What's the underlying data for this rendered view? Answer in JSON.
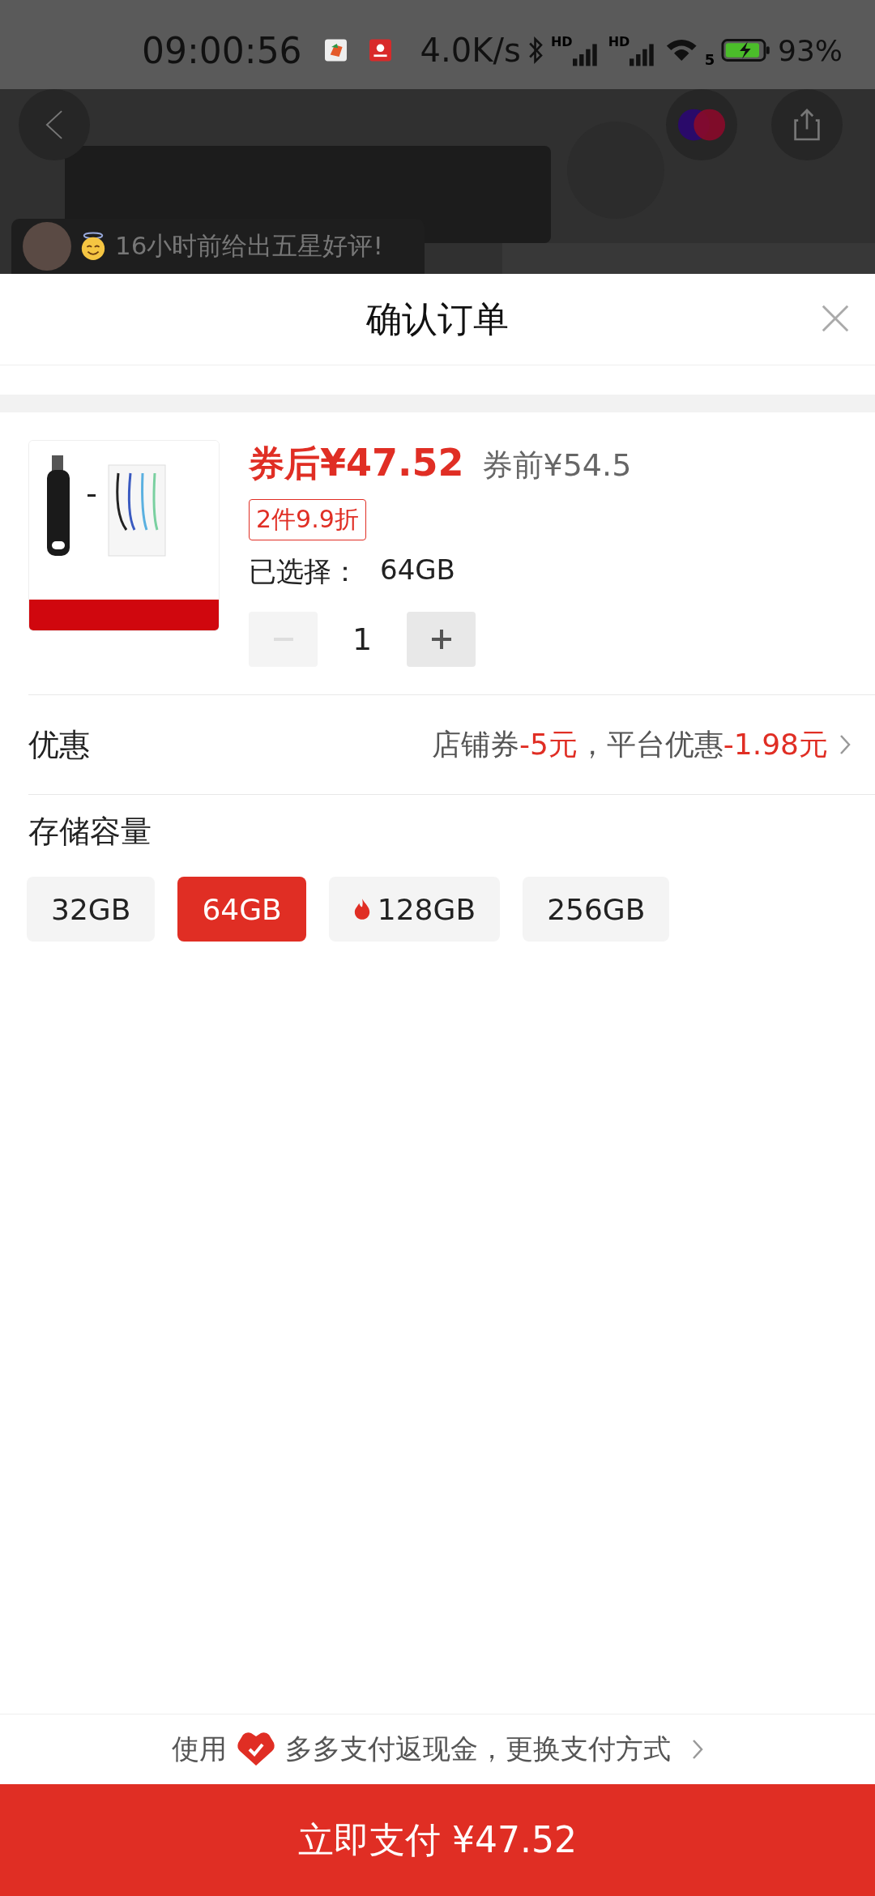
{
  "status_bar": {
    "time": "09:00:56",
    "speed": "4.0K/s",
    "signal_labels": [
      "HD",
      "HD"
    ],
    "wifi_label": "5",
    "battery": "93%",
    "charging": true
  },
  "review_toast": {
    "text": "16小时前给出五星好评!"
  },
  "sheet": {
    "title": "确认订单"
  },
  "product": {
    "price_label": "券后",
    "price": "¥47.52",
    "original_price": "券前¥54.5",
    "promo_tag": "2件9.9折",
    "selected_label": "已选择：",
    "selected_value": "64GB",
    "quantity": "1",
    "minus_disabled": true
  },
  "discount": {
    "label": "优惠",
    "parts": [
      {
        "text": "店铺券",
        "kind": "plain"
      },
      {
        "text": "-5元",
        "kind": "amount"
      },
      {
        "text": "，平台优惠",
        "kind": "plain"
      },
      {
        "text": "-1.98元",
        "kind": "amount"
      }
    ]
  },
  "options": {
    "title": "存储容量",
    "items": [
      {
        "label": "32GB",
        "selected": false,
        "hot": false
      },
      {
        "label": "64GB",
        "selected": true,
        "hot": false
      },
      {
        "label": "128GB",
        "selected": false,
        "hot": true
      },
      {
        "label": "256GB",
        "selected": false,
        "hot": false
      }
    ]
  },
  "payment_hint": {
    "prefix": "使用",
    "text": "多多支付返现金，更换支付方式"
  },
  "pay_button": "立即支付 ¥47.52"
}
